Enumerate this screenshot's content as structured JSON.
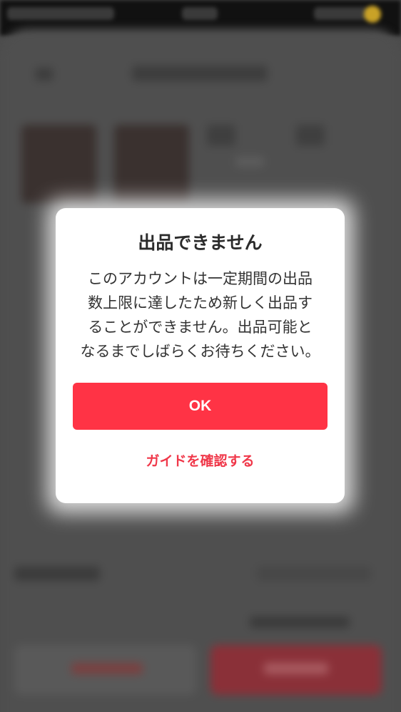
{
  "dialog": {
    "title": "出品できません",
    "message": "このアカウントは一定期間の出品\n数上限に達したため新しく出品す\nることができません。出品可能と\nなるまでしばらくお待ちください。",
    "ok_label": "OK",
    "guide_label": "ガイドを確認する"
  },
  "colors": {
    "accent": "#ff3345",
    "link": "#f0384a",
    "dialog_bg": "#ffffff"
  }
}
